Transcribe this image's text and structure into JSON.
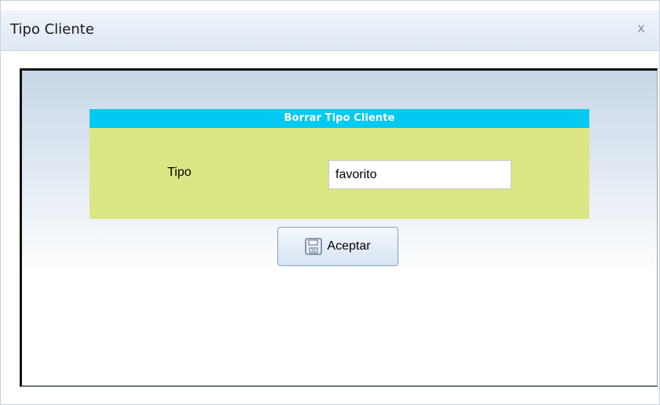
{
  "window": {
    "title": "Tipo Cliente",
    "close_label": "x"
  },
  "panel": {
    "header": "Borrar Tipo Cliente",
    "field_label": "Tipo",
    "field_value": "favorito"
  },
  "actions": {
    "accept_label": "Aceptar",
    "accept_icon": "save-icon"
  },
  "colors": {
    "panel_header": "#00c9f2",
    "panel_body": "#dbe685",
    "titlebar": "#e6eef8"
  }
}
